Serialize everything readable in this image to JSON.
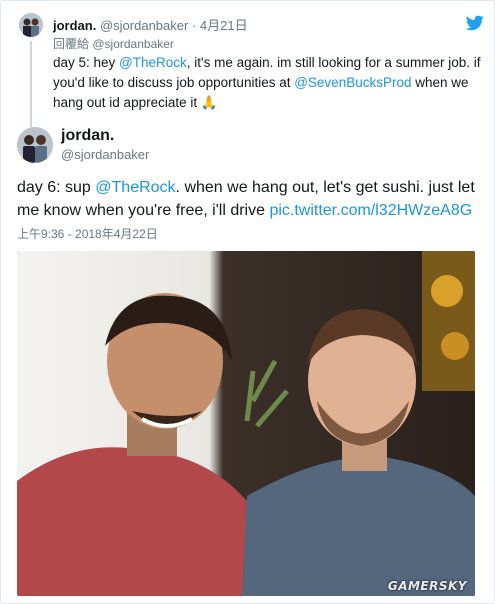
{
  "parent_tweet": {
    "name": "jordan.",
    "handle": "@sjordanbaker",
    "separator": "·",
    "date": "4月21日",
    "reply_prefix": "回覆給",
    "reply_handle": "@sjordanbaker",
    "text_part1": "day 5: hey ",
    "mention1": "@TheRock",
    "text_part2": ", it's me again. im still looking for a summer job. if you'd like to discuss job opportunities at ",
    "mention2": "@SevenBucksProd",
    "text_part3": " when we hang out id appreciate it ",
    "emoji": "🙏",
    "brand_icon": "twitter-bird-icon"
  },
  "main_tweet": {
    "name": "jordan.",
    "handle": "@sjordanbaker",
    "text_part1": "day 6: sup ",
    "mention": "@TheRock",
    "text_part2": ". when we hang out, let's get sushi. just let me know when you're free, i'll drive ",
    "link": "pic.twitter.com/l32HWzeA8G",
    "timestamp": "上午9:36 - 2018年4月22日"
  },
  "watermark": "GAMERSKY",
  "colors": {
    "link": "#1b95e0",
    "text": "#14171a",
    "muted": "#657786",
    "brand": "#1da1f2"
  }
}
